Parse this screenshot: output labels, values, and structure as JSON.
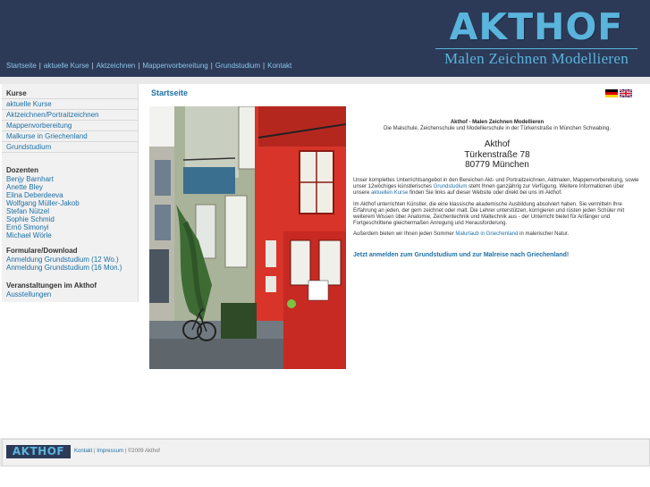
{
  "header": {
    "logo_text": "AKTHOF",
    "logo_subtitle": "Malen Zeichnen Modellieren",
    "nav": [
      "Startseite",
      "aktuelle Kurse",
      "Aktzeichnen",
      "Mappenvorbereitung",
      "Grundstudium",
      "Kontakt"
    ]
  },
  "sidebar": {
    "kurse_heading": "Kurse",
    "kurse": [
      "aktuelle Kurse",
      "Aktzeichnen/Portraitzeichnen",
      "Mappenvorbereitung",
      "Malkurse in Griechenland",
      "Grundstudium"
    ],
    "dozenten_heading": "Dozenten",
    "dozenten": [
      "Benjy Barnhart",
      "Anette Bley",
      "Elina Deberdeeva",
      "Wolfgang Müller-Jakob",
      "Stefan Nützel",
      "Sophie Schmid",
      "Ernö Simonyi",
      "Michael Wörle"
    ],
    "formulare_heading": "Formulare/Download",
    "formulare": [
      "Anmeldung Grundstudium (12 Wo.)",
      "Anmeldung Grundstudium (16 Mon.)"
    ],
    "veranstaltungen_heading": "Veranstaltungen im Akthof",
    "veranstaltungen": [
      "Ausstellungen"
    ]
  },
  "main": {
    "title": "Startseite",
    "intro_title": "Akthof - Malen Zeichnen Modellieren",
    "intro_text": "Die Malschule, Zeichenschule und Modellierschule in der Türkenstraße in München Schwabing.",
    "address_name": "Akthof",
    "address_street": "Türkenstraße 78",
    "address_city": "80779 München",
    "p1_a": "Unser komplettes Unterrichtsangebot in den Bereichen Akt- und Portraitzeichnen, Aktmalen, Mappenvorbereitung, sowie unser 12wöchiges künstlerisches ",
    "p1_link1": "Grundstudium",
    "p1_b": " steht Ihnen ganzjährig zur Verfügung. Weitere Informationen über unsere ",
    "p1_link2": "aktuellen Kurse",
    "p1_c": " finden Sie links auf dieser Website oder direkt bei uns im Akthof.",
    "p2": "Im Akthof unterrichten Künstler, die eine klassische akademische Ausbildung absolviert haben. Sie vermitteln Ihre Erfahrung an jeden, der gern zeichnet oder malt. Die Lehrer unterstützen, korrigieren und rüsten jeden Schüler mit weiterem Wissen über Anatomie, Zeichentechnik und Maltechnik aus - der Unterricht bietet für Anfänger und Fortgeschrittene gleichermaßen Anregung und Herausforderung.",
    "p3_a": "Außerdem bieten wir Ihnen jeden Sommer ",
    "p3_link": "Malurlaub in Griechenland",
    "p3_b": " in malerischer Natur.",
    "cta": "Jetzt anmelden zum Grundstudium und zur Malreise nach Griechenland!"
  },
  "footer": {
    "logo_text": "AKTHOF",
    "kontakt": "Kontakt",
    "impressum": "Impressum",
    "copyright": "©2009 Akthof"
  },
  "colors": {
    "header_bg": "#2c3a58",
    "accent": "#5ab4dc",
    "link": "#1d6fa5"
  }
}
